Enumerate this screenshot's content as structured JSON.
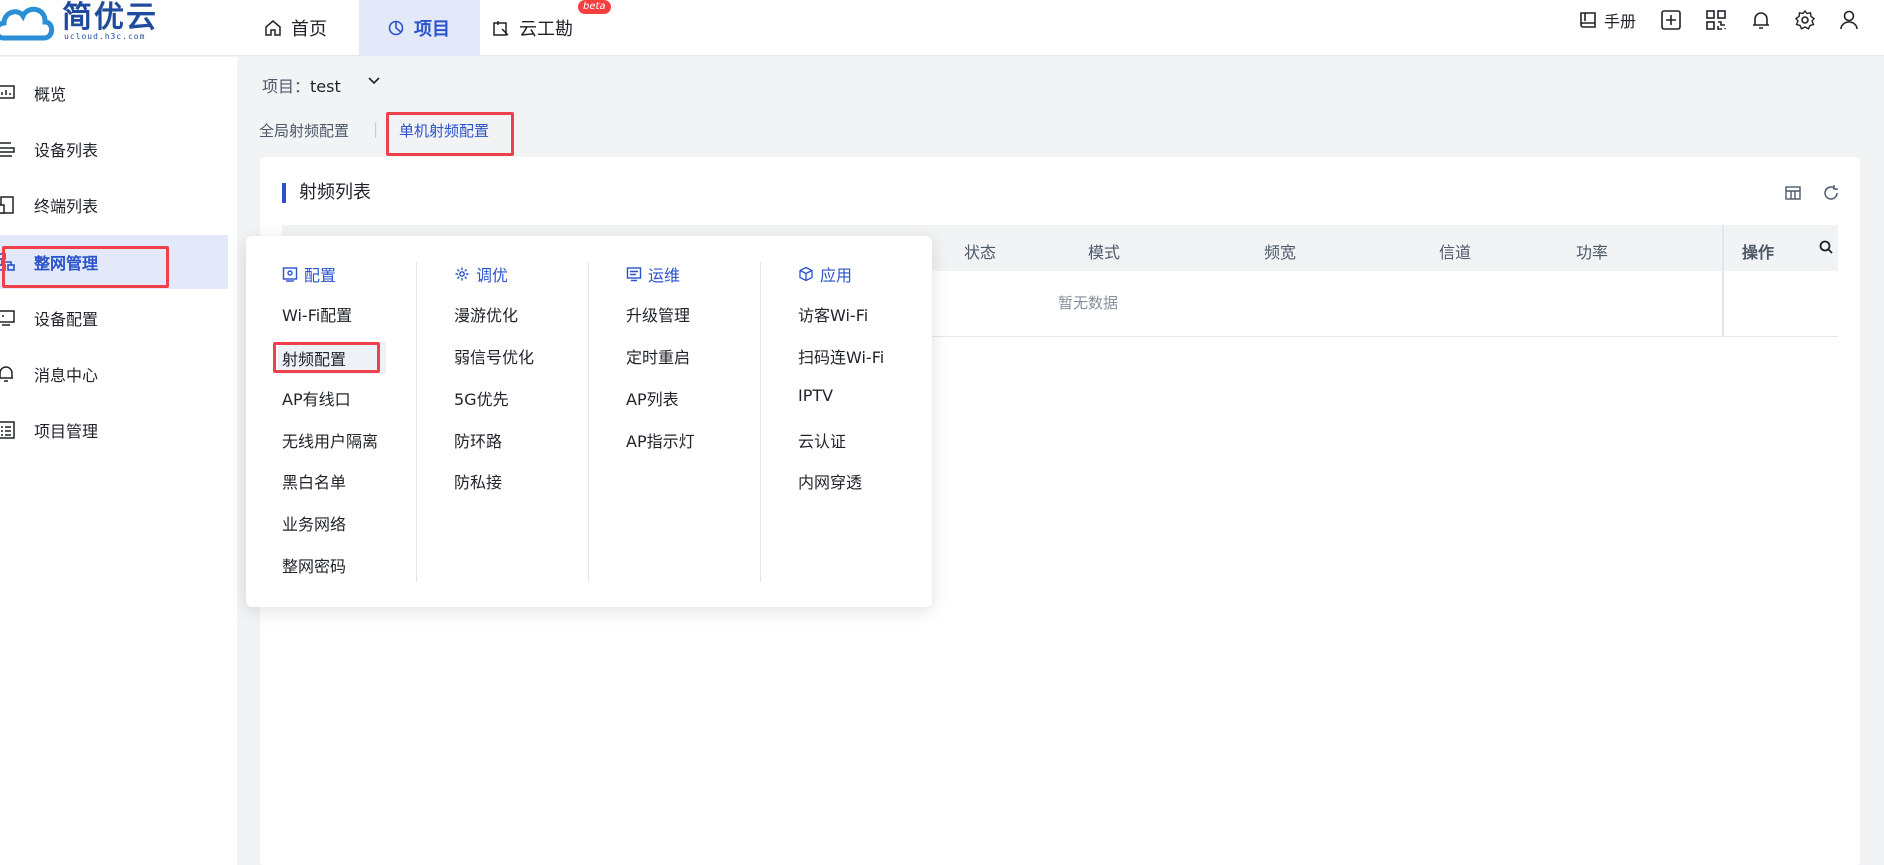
{
  "logo": {
    "brand": "简优云",
    "sub": "ucloud.h3c.com"
  },
  "nav": {
    "home": "首页",
    "project": "项目",
    "cloud_survey": "云工勘",
    "beta": "beta"
  },
  "toolbar": {
    "manual": "手册"
  },
  "sidebar": {
    "items": [
      {
        "label": "概览",
        "icon": "chart-icon"
      },
      {
        "label": "设备列表",
        "icon": "device-list-icon"
      },
      {
        "label": "终端列表",
        "icon": "terminal-icon"
      },
      {
        "label": "整网管理",
        "icon": "network-icon"
      },
      {
        "label": "设备配置",
        "icon": "device-config-icon"
      },
      {
        "label": "消息中心",
        "icon": "bell-icon"
      },
      {
        "label": "项目管理",
        "icon": "project-icon"
      }
    ]
  },
  "project_bar": {
    "label": "项目：",
    "value": "test"
  },
  "subtabs": {
    "global": "全局射频配置",
    "separator": "|",
    "single": "单机射频配置"
  },
  "card": {
    "title": "射频列表",
    "columns": [
      "状态",
      "模式",
      "频宽",
      "信道",
      "功率"
    ],
    "op_column": "操作",
    "empty": "暂无数据"
  },
  "menu": {
    "config": {
      "title": "配置",
      "items": [
        "Wi-Fi配置",
        "射频配置",
        "AP有线口",
        "无线用户隔离",
        "黑白名单",
        "业务网络",
        "整网密码"
      ]
    },
    "tuning": {
      "title": "调优",
      "items": [
        "漫游优化",
        "弱信号优化",
        "5G优先",
        "防环路",
        "防私接"
      ]
    },
    "ops": {
      "title": "运维",
      "items": [
        "升级管理",
        "定时重启",
        "AP列表",
        "AP指示灯"
      ]
    },
    "apps": {
      "title": "应用",
      "items": [
        "访客Wi-Fi",
        "扫码连Wi-Fi",
        "IPTV",
        "云认证",
        "内网穿透"
      ]
    }
  },
  "colors": {
    "accent": "#2a53cc",
    "active_bg": "#e3e9f8",
    "annotation": "#f0404b"
  }
}
